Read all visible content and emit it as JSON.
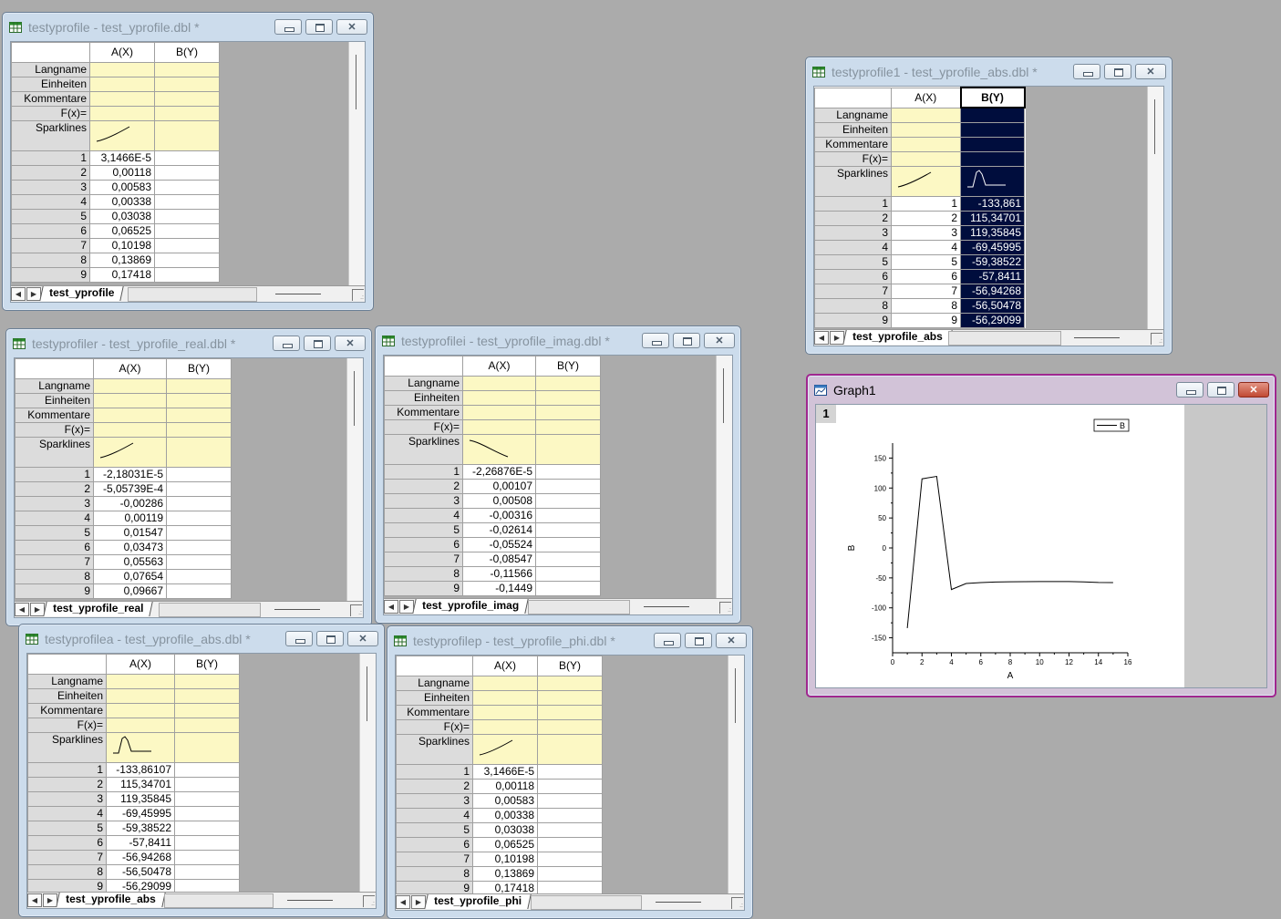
{
  "labels": {
    "langname": "Langname",
    "einheiten": "Einheiten",
    "kommentare": "Kommentare",
    "fx": "F(x)=",
    "sparklines": "Sparklines"
  },
  "windows": [
    {
      "key": "w1",
      "title": "testyprofile - test_yprofile.dbl *",
      "colA": "A(X)",
      "colB": "B(Y)",
      "tab": "test_yprofile",
      "rows": [
        [
          "1",
          "3,1466E-5",
          ""
        ],
        [
          "2",
          "0,00118",
          ""
        ],
        [
          "3",
          "0,00583",
          ""
        ],
        [
          "4",
          "0,00338",
          ""
        ],
        [
          "5",
          "0,03038",
          ""
        ],
        [
          "6",
          "0,06525",
          ""
        ],
        [
          "7",
          "0,10198",
          ""
        ],
        [
          "8",
          "0,13869",
          ""
        ],
        [
          "9",
          "0,17418",
          ""
        ]
      ]
    },
    {
      "key": "w2",
      "title": "testyprofile1 - test_yprofile_abs.dbl *",
      "colA": "A(X)",
      "colB": "B(Y)",
      "tab": "test_yprofile_abs",
      "rows": [
        [
          "1",
          "1",
          "-133,861"
        ],
        [
          "2",
          "2",
          "115,34701"
        ],
        [
          "3",
          "3",
          "119,35845"
        ],
        [
          "4",
          "4",
          "-69,45995"
        ],
        [
          "5",
          "5",
          "-59,38522"
        ],
        [
          "6",
          "6",
          "-57,8411"
        ],
        [
          "7",
          "7",
          "-56,94268"
        ],
        [
          "8",
          "8",
          "-56,50478"
        ],
        [
          "9",
          "9",
          "-56,29099"
        ]
      ]
    },
    {
      "key": "w3",
      "title": "testyprofiler - test_yprofile_real.dbl *",
      "colA": "A(X)",
      "colB": "B(Y)",
      "tab": "test_yprofile_real",
      "rows": [
        [
          "1",
          "-2,18031E-5",
          ""
        ],
        [
          "2",
          "-5,05739E-4",
          ""
        ],
        [
          "3",
          "-0,00286",
          ""
        ],
        [
          "4",
          "0,00119",
          ""
        ],
        [
          "5",
          "0,01547",
          ""
        ],
        [
          "6",
          "0,03473",
          ""
        ],
        [
          "7",
          "0,05563",
          ""
        ],
        [
          "8",
          "0,07654",
          ""
        ],
        [
          "9",
          "0,09667",
          ""
        ]
      ]
    },
    {
      "key": "w4",
      "title": "testyprofilei - test_yprofile_imag.dbl *",
      "colA": "A(X)",
      "colB": "B(Y)",
      "tab": "test_yprofile_imag",
      "rows": [
        [
          "1",
          "-2,26876E-5",
          ""
        ],
        [
          "2",
          "0,00107",
          ""
        ],
        [
          "3",
          "0,00508",
          ""
        ],
        [
          "4",
          "-0,00316",
          ""
        ],
        [
          "5",
          "-0,02614",
          ""
        ],
        [
          "6",
          "-0,05524",
          ""
        ],
        [
          "7",
          "-0,08547",
          ""
        ],
        [
          "8",
          "-0,11566",
          ""
        ],
        [
          "9",
          "-0,1449",
          ""
        ]
      ]
    },
    {
      "key": "w5",
      "title": "testyprofilea - test_yprofile_abs.dbl *",
      "colA": "A(X)",
      "colB": "B(Y)",
      "tab": "test_yprofile_abs",
      "rows": [
        [
          "1",
          "-133,86107",
          ""
        ],
        [
          "2",
          "115,34701",
          ""
        ],
        [
          "3",
          "119,35845",
          ""
        ],
        [
          "4",
          "-69,45995",
          ""
        ],
        [
          "5",
          "-59,38522",
          ""
        ],
        [
          "6",
          "-57,8411",
          ""
        ],
        [
          "7",
          "-56,94268",
          ""
        ],
        [
          "8",
          "-56,50478",
          ""
        ],
        [
          "9",
          "-56,29099",
          ""
        ]
      ]
    },
    {
      "key": "w6",
      "title": "testyprofilep - test_yprofile_phi.dbl *",
      "colA": "A(X)",
      "colB": "B(Y)",
      "tab": "test_yprofile_phi",
      "rows": [
        [
          "1",
          "3,1466E-5",
          ""
        ],
        [
          "2",
          "0,00118",
          ""
        ],
        [
          "3",
          "0,00583",
          ""
        ],
        [
          "4",
          "0,00338",
          ""
        ],
        [
          "5",
          "0,03038",
          ""
        ],
        [
          "6",
          "0,06525",
          ""
        ],
        [
          "7",
          "0,10198",
          ""
        ],
        [
          "8",
          "0,13869",
          ""
        ],
        [
          "9",
          "0,17418",
          ""
        ]
      ]
    }
  ],
  "graph": {
    "title": "Graph1",
    "layer": "1",
    "chart_data": {
      "type": "line",
      "xlabel": "A",
      "ylabel": "B",
      "xlim": [
        0,
        16
      ],
      "ylim": [
        -175,
        175
      ],
      "xticks": [
        0,
        2,
        4,
        6,
        8,
        10,
        12,
        14,
        16
      ],
      "yticks": [
        -150,
        -100,
        -50,
        0,
        50,
        100,
        150
      ],
      "series": [
        {
          "name": "B",
          "x": [
            1,
            2,
            3,
            4,
            5,
            6,
            7,
            8,
            9,
            10,
            11,
            12,
            13,
            14,
            15
          ],
          "y": [
            -133.861,
            115.34701,
            119.35845,
            -69.45995,
            -59.38522,
            -57.8411,
            -56.94268,
            -56.50478,
            -56.29099,
            -56.2,
            -56.15,
            -56.1,
            -56.6,
            -57.6,
            -57.9
          ]
        }
      ]
    }
  }
}
